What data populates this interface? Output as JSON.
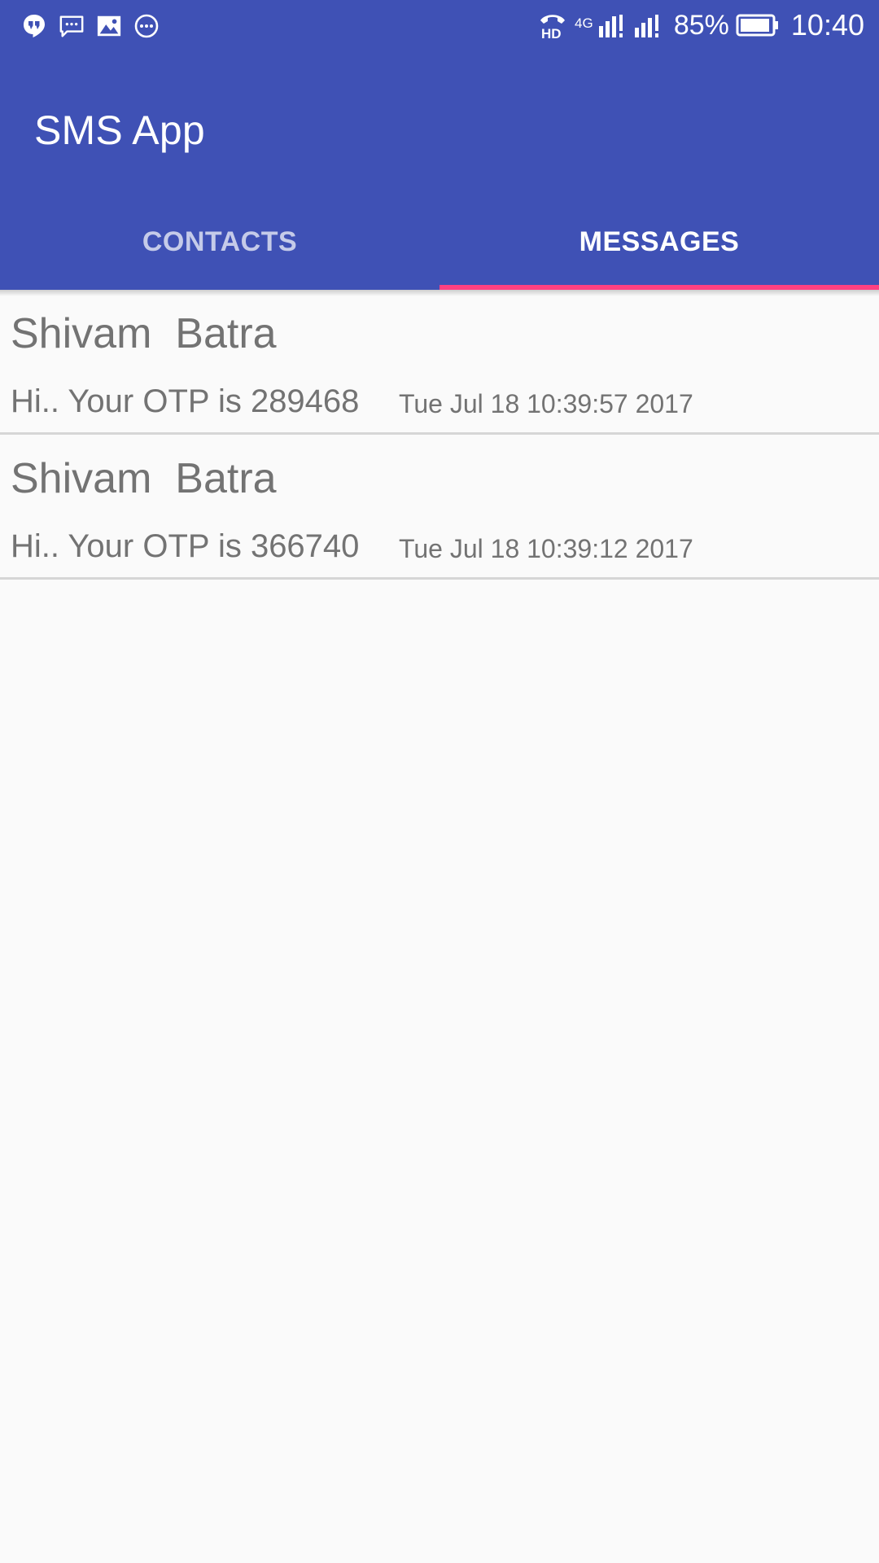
{
  "status_bar": {
    "left_icons": [
      "hangouts-icon",
      "sms-icon",
      "image-icon",
      "more-icon"
    ],
    "right_icons": [
      "hd-call-icon",
      "4g-signal-icon",
      "signal-icon",
      "battery-icon"
    ],
    "network_label": "4G",
    "battery": "85%",
    "time": "10:40"
  },
  "app": {
    "title": "SMS App"
  },
  "tabs": [
    {
      "label": "CONTACTS",
      "active": false
    },
    {
      "label": "MESSAGES",
      "active": true
    }
  ],
  "colors": {
    "primary": "#3f51b5",
    "accent": "#ff4081",
    "background": "#fafafa",
    "text": "#737373",
    "divider": "#d6d6d6"
  },
  "messages": [
    {
      "sender": "Shivam  Batra",
      "body": "Hi.. Your OTP is 289468",
      "date": "Tue Jul 18 10:39:57 2017"
    },
    {
      "sender": "Shivam  Batra",
      "body": "Hi.. Your OTP is 366740",
      "date": "Tue Jul 18 10:39:12 2017"
    }
  ]
}
